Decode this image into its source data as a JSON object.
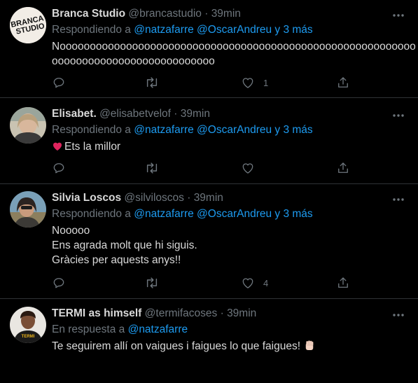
{
  "tweets": [
    {
      "name": "Branca Studio",
      "handle": "@brancastudio",
      "sep": "·",
      "time": "39min",
      "reply_prefix": "Respondiendo a ",
      "reply_mentions": "@natzafarre @OscarAndreu y 3 más",
      "body_lines": [
        "Nooooooooooooooooooooooooooooooooooooooooooooooooooooooooooo",
        "ooooooooooooooooooooooooooo"
      ],
      "avatar_text": "BRANCA STUDIO",
      "like_count": "1",
      "retweet_count": ""
    },
    {
      "name": "Elisabet.",
      "handle": "@elisabetvelof",
      "sep": "·",
      "time": "39min",
      "reply_prefix": "Respondiendo a ",
      "reply_mentions": "@natzafarre @OscarAndreu y 3 más",
      "body_lines": [
        "Ets la millor"
      ],
      "like_count": "",
      "retweet_count": ""
    },
    {
      "name": "Silvia Loscos",
      "handle": "@silviloscos",
      "sep": "·",
      "time": "39min",
      "reply_prefix": "Respondiendo a ",
      "reply_mentions": "@natzafarre @OscarAndreu y 3 más",
      "body_lines": [
        "Nooooo",
        "Ens agrada molt que hi siguis.",
        "Gràcies per aquests anys!!"
      ],
      "like_count": "4",
      "retweet_count": ""
    },
    {
      "name": "TERMI as himself",
      "handle": "@termifacoses",
      "sep": "·",
      "time": "39min",
      "reply_prefix": "En respuesta a ",
      "reply_mentions": "@natzafarre",
      "body_lines": [
        "Te seguirem allí on vaigues i faigues lo que faigues!"
      ],
      "avatar_text": "TERMI"
    }
  ],
  "icons": {
    "reply": "reply-icon",
    "retweet": "retweet-icon",
    "like": "heart-icon",
    "share": "share-icon",
    "more": "more-icon"
  },
  "colors": {
    "background": "#000000",
    "text": "#d9d9d9",
    "muted": "#6e767d",
    "link": "#1d9bf0",
    "divider": "#2f3336"
  }
}
